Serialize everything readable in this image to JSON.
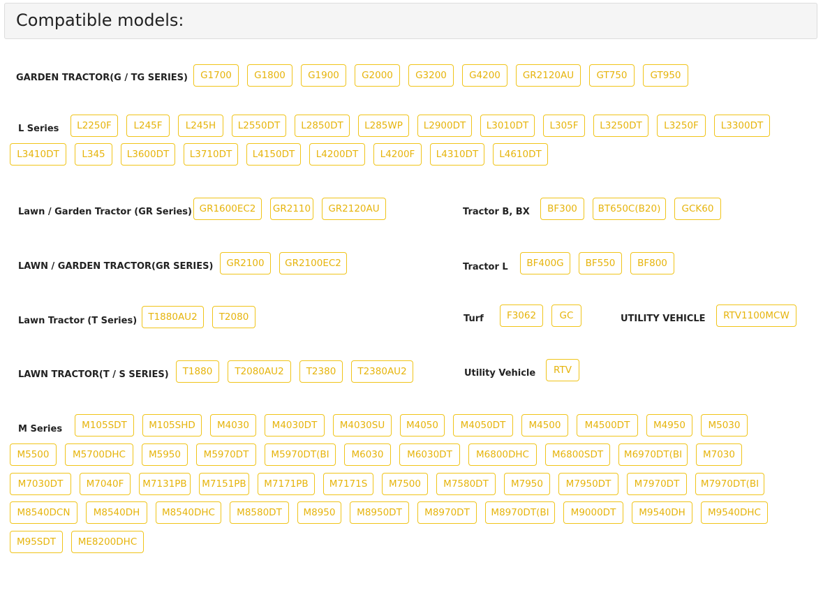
{
  "title": "Compatible models:",
  "groups": [
    {
      "id": "g1",
      "label": "GARDEN TRACTOR(G / TG SERIES)",
      "models": [
        "G1700",
        "G1800",
        "G1900",
        "G2000",
        "G3200",
        "G4200",
        "GR2120AU",
        "GT750",
        "GT950"
      ]
    },
    {
      "id": "g2",
      "label": "L Series",
      "models": [
        "L2250F",
        "L245F",
        "L245H",
        "L2550DT",
        "L2850DT",
        "L285WP",
        "L2900DT",
        "L3010DT",
        "L305F",
        "L3250DT",
        "L3250F",
        "L3300DT",
        "L3410DT",
        "L345",
        "L3600DT",
        "L3710DT",
        "L4150DT",
        "L4200DT",
        "L4200F",
        "L4310DT",
        "L4610DT"
      ]
    },
    {
      "id": "g3",
      "label": "Lawn / Garden Tractor (GR Series)",
      "models": [
        "GR1600EC2",
        "GR2110",
        "GR2120AU"
      ]
    },
    {
      "id": "g4",
      "label": "Tractor B, BX",
      "models": [
        "BF300",
        "BT650C(B20)",
        "GCK60"
      ]
    },
    {
      "id": "g5",
      "label": "LAWN / GARDEN TRACTOR(GR SERIES)",
      "models": [
        "GR2100",
        "GR2100EC2"
      ]
    },
    {
      "id": "g6",
      "label": "Tractor L",
      "models": [
        "BF400G",
        "BF550",
        "BF800"
      ]
    },
    {
      "id": "g7",
      "label": "Lawn Tractor (T Series)",
      "models": [
        "T1880AU2",
        "T2080"
      ]
    },
    {
      "id": "g8",
      "label": "Turf",
      "models": [
        "F3062",
        "GC"
      ]
    },
    {
      "id": "g9",
      "label": "UTILITY VEHICLE",
      "models": [
        "RTV1100MCW"
      ]
    },
    {
      "id": "g10",
      "label": "LAWN TRACTOR(T / S SERIES)",
      "models": [
        "T1880",
        "T2080AU2",
        "T2380",
        "T2380AU2"
      ]
    },
    {
      "id": "g11",
      "label": "Utility Vehicle",
      "models": [
        "RTV"
      ]
    },
    {
      "id": "g12",
      "label": "M Series",
      "models": [
        "M105SDT",
        "M105SHD",
        "M4030",
        "M4030DT",
        "M4030SU",
        "M4050",
        "M4050DT",
        "M4500",
        "M4500DT",
        "M4950",
        "M5030",
        "M5500",
        "M5700DHC",
        "M5950",
        "M5970DT",
        "M5970DT(BI",
        "M6030",
        "M6030DT",
        "M6800DHC",
        "M6800SDT",
        "M6970DT(BI",
        "M7030",
        "M7030DT",
        "M7040F",
        "M7131PB",
        "M7151PB",
        "M7171PB",
        "M7171S",
        "M7500",
        "M7580DT",
        "M7950",
        "M7950DT",
        "M7970DT",
        "M7970DT(BI",
        "M8540DCN",
        "M8540DH",
        "M8540DHC",
        "M8580DT",
        "M8950",
        "M8950DT",
        "M8970DT",
        "M8970DT(BI",
        "M9000DT",
        "M9540DH",
        "M9540DHC",
        "M95SDT",
        "ME8200DHC"
      ]
    }
  ],
  "accent_color": "#f0c419"
}
